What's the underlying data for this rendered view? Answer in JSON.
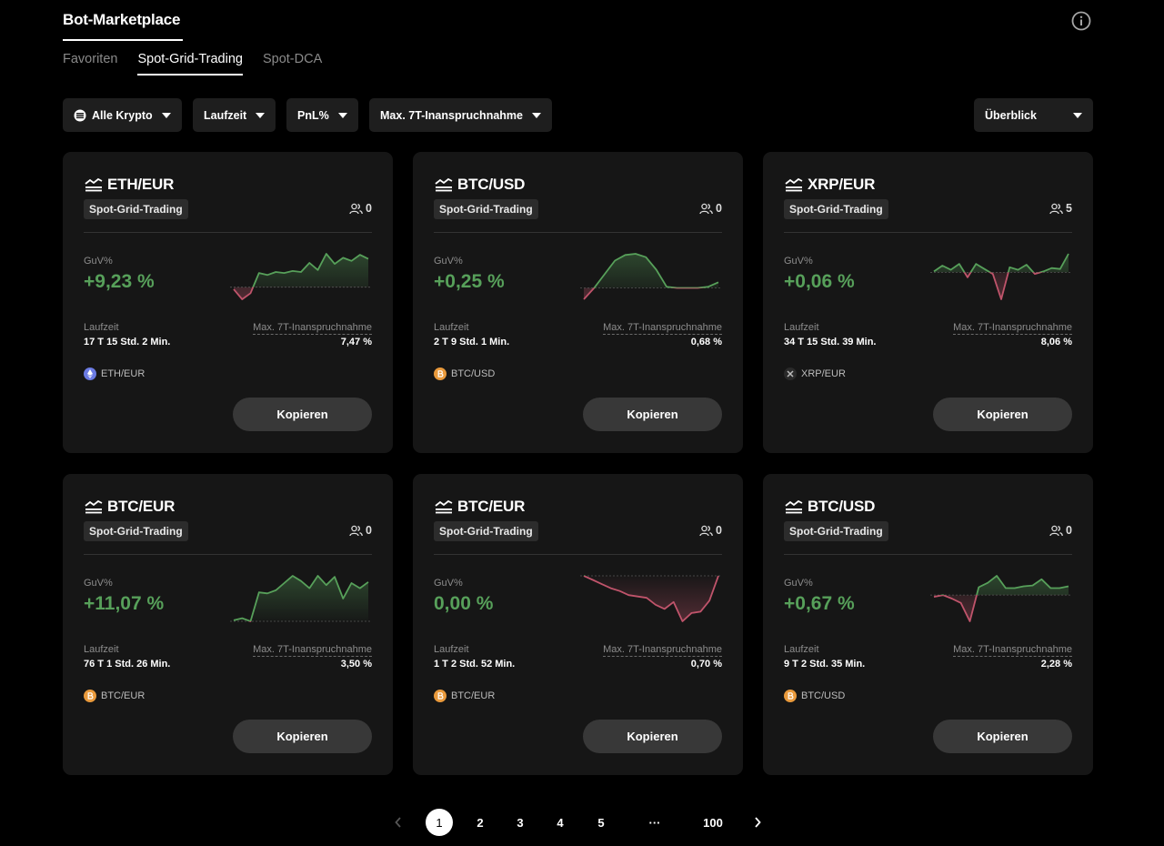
{
  "header": {
    "title": "Bot-Marketplace",
    "info_icon": "info-circle-icon"
  },
  "tabs": [
    {
      "label": "Favoriten",
      "active": false
    },
    {
      "label": "Spot-Grid-Trading",
      "active": true
    },
    {
      "label": "Spot-DCA",
      "active": false
    }
  ],
  "filters": {
    "coin": "Alle Krypto",
    "runtime": "Laufzeit",
    "pnl": "PnL%",
    "drawdown": "Max. 7T-Inanspruchnahme",
    "view": "Überblick"
  },
  "colors": {
    "positive": "#57a05a",
    "negative": "#c0546b",
    "background": "#000000",
    "card": "#161616"
  },
  "cards": [
    {
      "pair": "ETH/EUR",
      "badge": "Spot-Grid-Trading",
      "users": "0",
      "guv_label": "GuV%",
      "guv": "+9,23 %",
      "runtime_label": "Laufzeit",
      "runtime": "17 T 15 Std. 2 Min.",
      "drawdown_label": "Max. 7T-Inanspruchnahme",
      "drawdown": "7,47 %",
      "coin": "ETH/EUR",
      "coin_icon": "ethereum-icon",
      "button": "Kopieren"
    },
    {
      "pair": "BTC/USD",
      "badge": "Spot-Grid-Trading",
      "users": "0",
      "guv_label": "GuV%",
      "guv": "+0,25 %",
      "runtime_label": "Laufzeit",
      "runtime": "2 T 9 Std. 1 Min.",
      "drawdown_label": "Max. 7T-Inanspruchnahme",
      "drawdown": "0,68 %",
      "coin": "BTC/USD",
      "coin_icon": "bitcoin-icon",
      "button": "Kopieren"
    },
    {
      "pair": "XRP/EUR",
      "badge": "Spot-Grid-Trading",
      "users": "5",
      "guv_label": "GuV%",
      "guv": "+0,06 %",
      "runtime_label": "Laufzeit",
      "runtime": "34 T 15 Std. 39 Min.",
      "drawdown_label": "Max. 7T-Inanspruchnahme",
      "drawdown": "8,06 %",
      "coin": "XRP/EUR",
      "coin_icon": "xrp-icon",
      "button": "Kopieren"
    },
    {
      "pair": "BTC/EUR",
      "badge": "Spot-Grid-Trading",
      "users": "0",
      "guv_label": "GuV%",
      "guv": "+11,07 %",
      "runtime_label": "Laufzeit",
      "runtime": "76 T 1 Std. 26 Min.",
      "drawdown_label": "Max. 7T-Inanspruchnahme",
      "drawdown": "3,50 %",
      "coin": "BTC/EUR",
      "coin_icon": "bitcoin-icon",
      "button": "Kopieren"
    },
    {
      "pair": "BTC/EUR",
      "badge": "Spot-Grid-Trading",
      "users": "0",
      "guv_label": "GuV%",
      "guv": "0,00 %",
      "runtime_label": "Laufzeit",
      "runtime": "1 T 2 Std. 52 Min.",
      "drawdown_label": "Max. 7T-Inanspruchnahme",
      "drawdown": "0,70 %",
      "coin": "BTC/EUR",
      "coin_icon": "bitcoin-icon",
      "button": "Kopieren"
    },
    {
      "pair": "BTC/USD",
      "badge": "Spot-Grid-Trading",
      "users": "0",
      "guv_label": "GuV%",
      "guv": "+0,67 %",
      "runtime_label": "Laufzeit",
      "runtime": "9 T 2 Std. 35 Min.",
      "drawdown_label": "Max. 7T-Inanspruchnahme",
      "drawdown": "2,28 %",
      "coin": "BTC/USD",
      "coin_icon": "bitcoin-icon",
      "button": "Kopieren"
    }
  ],
  "sparklines": [
    [
      -0.2,
      -1.2,
      -0.6,
      1.4,
      1.2,
      1.5,
      1.4,
      1.6,
      1.5,
      2.4,
      1.7,
      3.3,
      2.3,
      2.9,
      2.6,
      3.2,
      2.8
    ],
    [
      -1.0,
      0.0,
      1.2,
      2.4,
      2.9,
      3.0,
      2.7,
      1.6,
      0.1,
      0.0,
      0.0,
      0.0,
      0.1,
      0.5
    ],
    [
      0.1,
      0.8,
      0.3,
      1.0,
      -0.6,
      1.0,
      0.4,
      -0.2,
      -3.2,
      0.6,
      0.3,
      0.9,
      -0.2,
      0.1,
      0.5,
      0.4,
      2.2
    ],
    [
      0.1,
      0.3,
      0.0,
      2.8,
      2.7,
      3.0,
      3.7,
      4.4,
      3.9,
      3.2,
      4.4,
      3.5,
      4.3,
      2.2,
      3.7,
      3.2,
      3.8
    ],
    [
      0.0,
      -0.3,
      -0.6,
      -0.9,
      -1.1,
      -1.4,
      -1.5,
      -1.6,
      -2.1,
      -2.4,
      -1.9,
      -3.3,
      -2.7,
      -2.6,
      -1.8,
      0.0
    ],
    [
      -0.2,
      0.0,
      -0.4,
      -0.9,
      -3.0,
      0.9,
      1.4,
      2.2,
      0.8,
      0.8,
      1.0,
      1.1,
      1.8,
      0.8,
      0.8,
      1.0
    ]
  ],
  "pagination": {
    "pages": [
      "1",
      "2",
      "3",
      "4",
      "5"
    ],
    "ellipsis": "···",
    "last": "100",
    "current": "1"
  }
}
